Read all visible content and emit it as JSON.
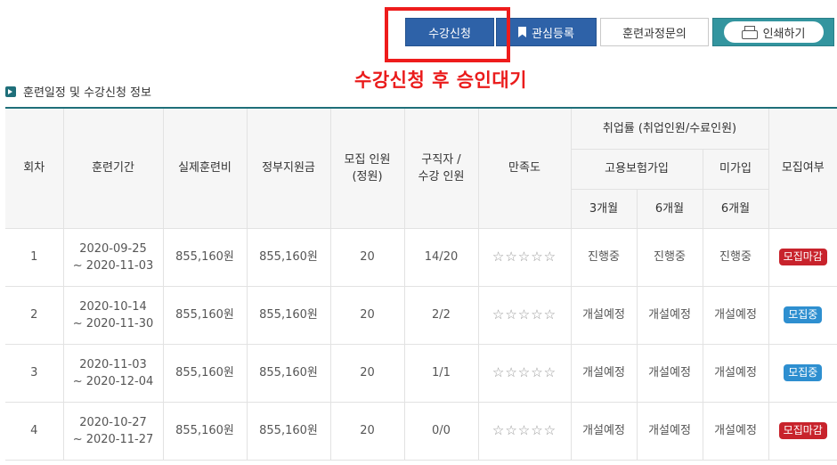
{
  "toolbar": {
    "apply_label": "수강신청",
    "bookmark_label": "관심등록",
    "inquiry_label": "훈련과정문의",
    "print_label": "인쇄하기"
  },
  "annotation": {
    "text": "수강신청 후 승인대기"
  },
  "section": {
    "title": "훈련일정 및 수강신청 정보"
  },
  "table": {
    "headers": {
      "round": "회차",
      "period": "훈련기간",
      "actual_fee": "실제훈련비",
      "gov_support": "정부지원금",
      "capacity_l1": "모집 인원",
      "capacity_l2": "(정원)",
      "applicants_l1": "구직자 /",
      "applicants_l2": "수강 인원",
      "satisfaction": "만족도",
      "employment": "취업률 (취업인원/수료인원)",
      "insured": "고용보험가입",
      "uninsured": "미가입",
      "m3": "3개월",
      "m6": "6개월",
      "m6b": "6개월",
      "status": "모집여부"
    },
    "rows": [
      {
        "round": "1",
        "start": "2020-09-25",
        "end": "~ 2020-11-03",
        "actual_fee": "855,160원",
        "gov_support": "855,160원",
        "capacity": "20",
        "applicants": "14/20",
        "stars": "☆☆☆☆☆",
        "ins_3m": "진행중",
        "ins_6m": "진행중",
        "unins_6m": "진행중",
        "status": "모집마감",
        "status_color": "#c8232c"
      },
      {
        "round": "2",
        "start": "2020-10-14",
        "end": "~ 2020-11-30",
        "actual_fee": "855,160원",
        "gov_support": "855,160원",
        "capacity": "20",
        "applicants": "2/2",
        "stars": "☆☆☆☆☆",
        "ins_3m": "개설예정",
        "ins_6m": "개설예정",
        "unins_6m": "개설예정",
        "status": "모집중",
        "status_color": "#2e8fd0"
      },
      {
        "round": "3",
        "start": "2020-11-03",
        "end": "~ 2020-12-04",
        "actual_fee": "855,160원",
        "gov_support": "855,160원",
        "capacity": "20",
        "applicants": "1/1",
        "stars": "☆☆☆☆☆",
        "ins_3m": "개설예정",
        "ins_6m": "개설예정",
        "unins_6m": "개설예정",
        "status": "모집중",
        "status_color": "#2e8fd0"
      },
      {
        "round": "4",
        "start": "2020-10-27",
        "end": "~ 2020-11-27",
        "actual_fee": "855,160원",
        "gov_support": "855,160원",
        "capacity": "20",
        "applicants": "0/0",
        "stars": "☆☆☆☆☆",
        "ins_3m": "개설예정",
        "ins_6m": "개설예정",
        "unins_6m": "개설예정",
        "status": "모집마감",
        "status_color": "#c8232c"
      }
    ]
  }
}
